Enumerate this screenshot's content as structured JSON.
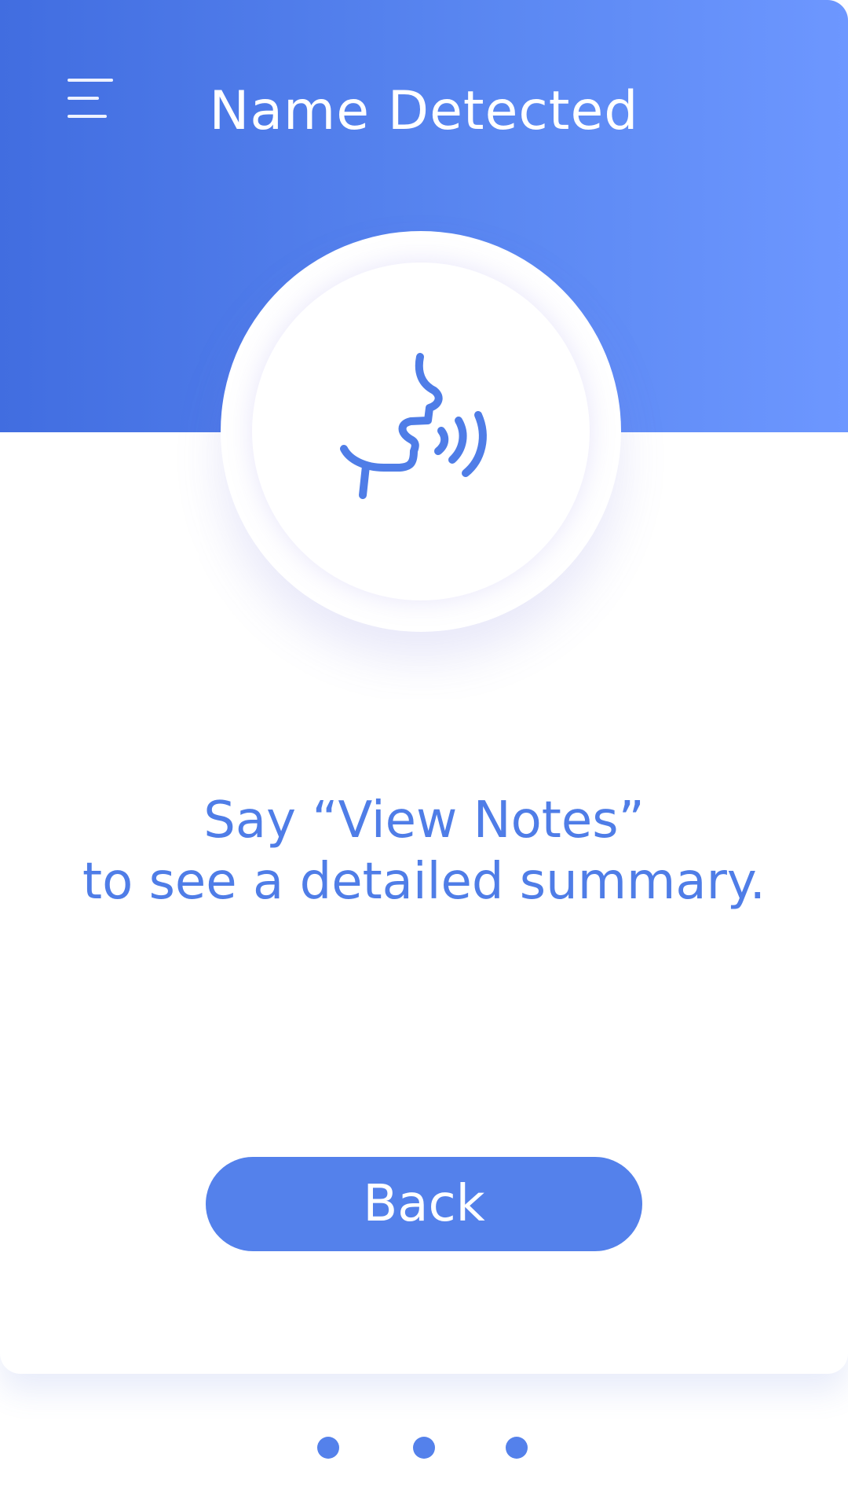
{
  "header": {
    "title": "Name Detected",
    "menu_icon": "menu-icon"
  },
  "main": {
    "icon": "speaking-head-icon",
    "instruction_line1": "Say “View Notes”",
    "instruction_line2": "to see a detailed summary.",
    "back_label": "Back"
  },
  "pager": {
    "pages": 3
  },
  "colors": {
    "header_gradient_start": "#416de0",
    "header_gradient_end": "#6d97ff",
    "accent": "#5481eb",
    "text_accent": "#4f7de7"
  }
}
